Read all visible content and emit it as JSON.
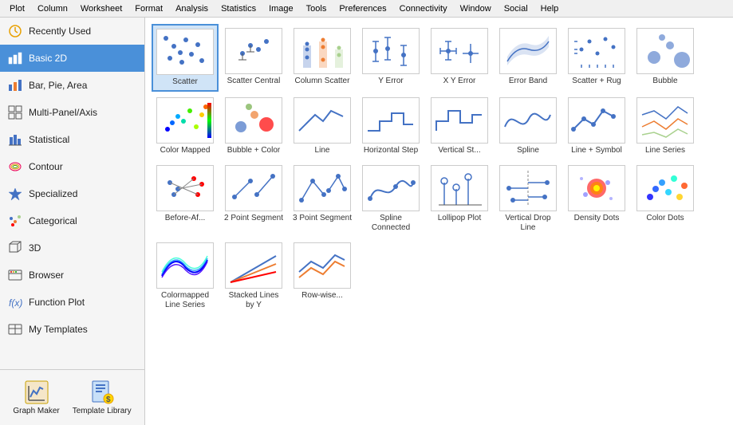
{
  "menuBar": {
    "items": [
      "Plot",
      "Column",
      "Worksheet",
      "Format",
      "Analysis",
      "Statistics",
      "Image",
      "Tools",
      "Preferences",
      "Connectivity",
      "Window",
      "Social",
      "Help"
    ]
  },
  "sidebar": {
    "items": [
      {
        "id": "recently-used",
        "label": "Recently Used",
        "icon": "clock"
      },
      {
        "id": "basic-2d",
        "label": "Basic 2D",
        "icon": "basic2d",
        "active": true
      },
      {
        "id": "bar-pie-area",
        "label": "Bar, Pie, Area",
        "icon": "bar"
      },
      {
        "id": "multi-panel",
        "label": "Multi-Panel/Axis",
        "icon": "multi"
      },
      {
        "id": "statistical",
        "label": "Statistical",
        "icon": "stat"
      },
      {
        "id": "contour",
        "label": "Contour",
        "icon": "contour"
      },
      {
        "id": "specialized",
        "label": "Specialized",
        "icon": "specialized"
      },
      {
        "id": "categorical",
        "label": "Categorical",
        "icon": "categorical"
      },
      {
        "id": "3d",
        "label": "3D",
        "icon": "3d"
      },
      {
        "id": "browser",
        "label": "Browser",
        "icon": "browser"
      },
      {
        "id": "function-plot",
        "label": "Function Plot",
        "icon": "function"
      },
      {
        "id": "my-templates",
        "label": "My Templates",
        "icon": "templates"
      }
    ],
    "footer": [
      {
        "id": "graph-maker",
        "label": "Graph Maker",
        "icon": "graphmaker"
      },
      {
        "id": "template-library",
        "label": "Template Library",
        "icon": "templatelibrary"
      }
    ]
  },
  "charts": {
    "rows": [
      [
        {
          "id": "scatter",
          "label": "Scatter",
          "selected": true
        },
        {
          "id": "scatter-central",
          "label": "Scatter Central"
        },
        {
          "id": "column-scatter",
          "label": "Column Scatter"
        },
        {
          "id": "y-error",
          "label": "Y Error"
        },
        {
          "id": "x-y-error",
          "label": "X Y Error"
        },
        {
          "id": "error-band",
          "label": "Error Band"
        },
        {
          "id": "scatter-rug",
          "label": "Scatter + Rug"
        },
        {
          "id": "bubble",
          "label": "Bubble"
        },
        {
          "id": "color-mapped",
          "label": "Color Mapped"
        },
        {
          "id": "bubble-color",
          "label": "Bubble + Color"
        }
      ],
      [
        {
          "id": "line",
          "label": "Line"
        },
        {
          "id": "horizontal-step",
          "label": "Horizontal Step"
        },
        {
          "id": "vertical-step",
          "label": "Vertical St..."
        },
        {
          "id": "spline",
          "label": "Spline"
        },
        {
          "id": "line-symbol",
          "label": "Line + Symbol"
        },
        {
          "id": "line-series",
          "label": "Line Series"
        },
        {
          "id": "before-after",
          "label": "Before-Af..."
        },
        {
          "id": "2-point-segment",
          "label": "2 Point Segment"
        },
        {
          "id": "3-point-segment",
          "label": "3 Point Segment"
        },
        {
          "id": "spline-connected",
          "label": "Spline Connected"
        }
      ],
      [
        {
          "id": "lollipop-plot",
          "label": "Lollipop Plot"
        },
        {
          "id": "vertical-drop-line",
          "label": "Vertical Drop Line"
        },
        {
          "id": "density-dots",
          "label": "Density Dots"
        },
        {
          "id": "color-dots",
          "label": "Color Dots"
        },
        {
          "id": "colormap-line-series",
          "label": "Colormapped Line Series"
        },
        {
          "id": "stacked-lines",
          "label": "Stacked Lines by Y"
        },
        {
          "id": "row-wise",
          "label": "Row-wise..."
        }
      ]
    ]
  }
}
